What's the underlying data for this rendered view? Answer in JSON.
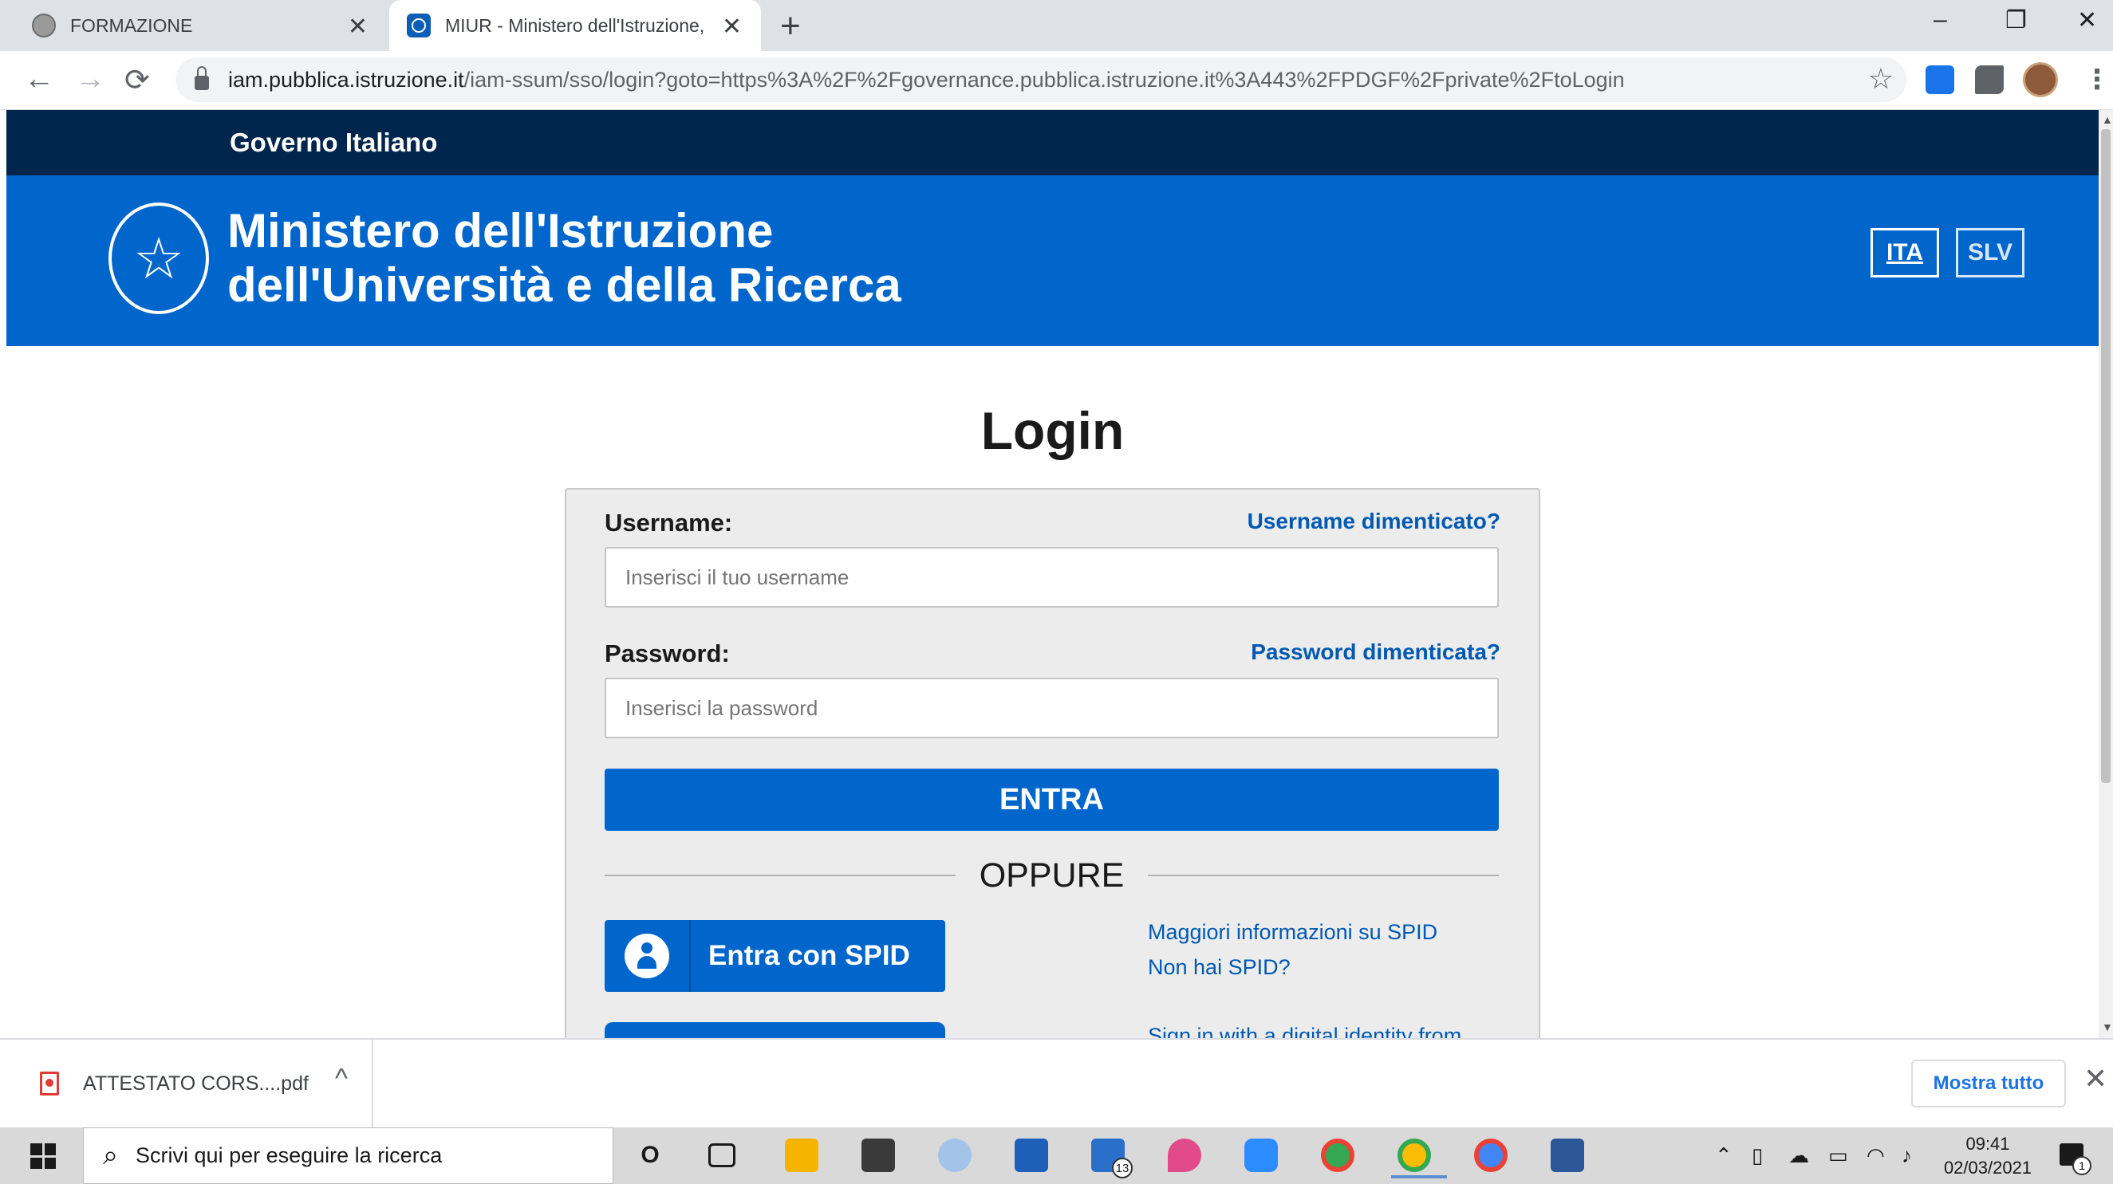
{
  "browser": {
    "tabs": [
      {
        "title": "FORMAZIONE",
        "close": "✕"
      },
      {
        "title": "MIUR - Ministero dell'Istruzione,",
        "close": "✕"
      }
    ],
    "new_tab": "+",
    "window": {
      "minimize": "–",
      "restore": "❐",
      "close": "✕"
    },
    "nav": {
      "back": "←",
      "forward": "→",
      "reload": "⟳"
    },
    "url_host": "iam.pubblica.istruzione.it",
    "url_path": "/iam-ssum/sso/login?goto=https%3A%2F%2Fgovernance.pubblica.istruzione.it%3A443%2FPDGF%2Fprivate%2FtoLogin",
    "bookmark_star": "☆",
    "menu": "⋮"
  },
  "gov_bar": {
    "label": "Governo Italiano"
  },
  "header": {
    "title_line1": "Ministero dell'Istruzione",
    "title_line2": "dell'Università e della Ricerca",
    "lang_ita": "ITA",
    "lang_slv": "SLV"
  },
  "login": {
    "title": "Login",
    "username_label": "Username:",
    "username_forgot": "Username dimenticato?",
    "username_placeholder": "Inserisci il tuo username",
    "password_label": "Password:",
    "password_forgot": "Password dimenticata?",
    "password_placeholder": "Inserisci la password",
    "submit": "ENTRA",
    "separator": "OPPURE",
    "spid_button": "Entra con SPID",
    "spid_info": "Maggiori informazioni su SPID",
    "spid_none": "Non hai SPID?",
    "eidas_link": "Sign in with a digital identity from"
  },
  "downloads": {
    "file_name": "ATTESTATO CORS....pdf",
    "chevron": "^",
    "show_all": "Mostra tutto",
    "close": "✕"
  },
  "taskbar": {
    "search_placeholder": "Scrivi qui per eseguire la ricerca",
    "cortana": "O",
    "mail_badge": "13",
    "clock_time": "09:41",
    "clock_date": "02/03/2021",
    "notification_badge": "1"
  }
}
